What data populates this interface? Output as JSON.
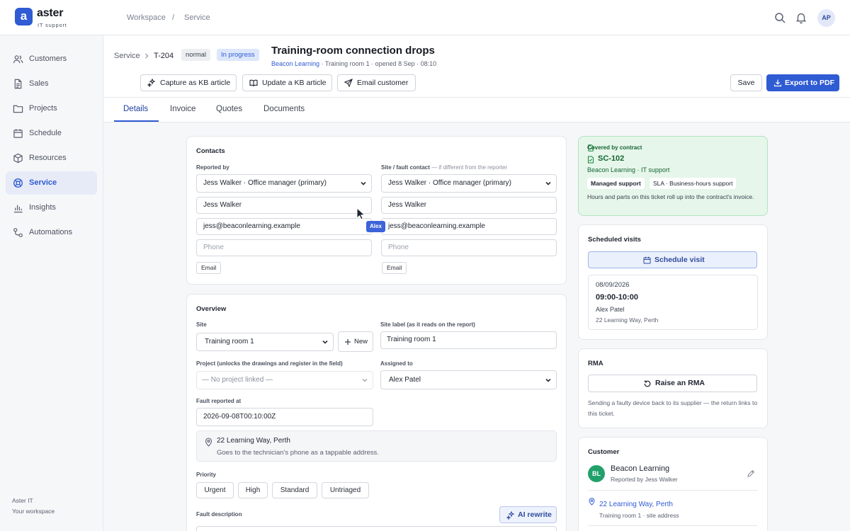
{
  "brand": {
    "logo_letter": "a",
    "name": "aster",
    "subtitle": "IT support"
  },
  "topbar": {
    "crumbs": [
      "Workspace",
      "/",
      "Service"
    ],
    "avatar": "AP"
  },
  "sidebar": {
    "items": [
      {
        "label": "Customers",
        "icon": "users-icon"
      },
      {
        "label": "Sales",
        "icon": "document-icon"
      },
      {
        "label": "Projects",
        "icon": "folder-icon"
      },
      {
        "label": "Schedule",
        "icon": "calendar-icon"
      },
      {
        "label": "Resources",
        "icon": "box-icon"
      },
      {
        "label": "Service",
        "icon": "lifebuoy-icon",
        "active": true
      },
      {
        "label": "Insights",
        "icon": "bar-chart-icon"
      },
      {
        "label": "Automations",
        "icon": "workflow-icon"
      }
    ],
    "footer_line1": "Aster IT",
    "footer_line2": "Your workspace"
  },
  "header": {
    "crumb_root": "Service",
    "ticket_id": "T-204",
    "priority_tag": "normal",
    "status_tag": "In progress",
    "title": "Training-room connection drops",
    "sub_link": "Beacon Learning",
    "sub_rest": " · Training room 1 · opened 8 Sep · 08:10",
    "actions": {
      "capture_kb": "Capture as KB article",
      "update_kb": "Update a KB article",
      "email_customer": "Email customer",
      "save": "Save",
      "export": "Export to PDF"
    }
  },
  "tabs": [
    "Details",
    "Invoice",
    "Quotes",
    "Documents"
  ],
  "contacts": {
    "title": "Contacts",
    "reported_by_label": "Reported by",
    "site_contact_label": "Site / fault contact",
    "site_contact_hint": " — if different from the reporter",
    "reporter": {
      "select": "Jess Walker · Office manager (primary)",
      "name": "Jess Walker",
      "email": "jess@beaconlearning.example",
      "phone_placeholder": "Phone",
      "chip": "Email"
    },
    "site_contact": {
      "select": "Jess Walker · Office manager (primary)",
      "name": "Jess Walker",
      "email": "jess@beaconlearning.example",
      "phone_placeholder": "Phone",
      "chip": "Email"
    },
    "presence_tag": "Alex"
  },
  "overview": {
    "title": "Overview",
    "site_label": "Site",
    "site_value": "Training room 1",
    "new_button": "New",
    "site_label_label": "Site label (as it reads on the report)",
    "site_label_value": "Training room 1",
    "project_label": "Project (unlocks the drawings and register in the field)",
    "project_value": "— No project linked —",
    "assigned_label": "Assigned to",
    "assigned_value": "Alex Patel",
    "fault_reported_label": "Fault reported at",
    "fault_reported_value": "2026-09-08T00:10:00Z",
    "address_line": "22 Learning Way, Perth",
    "address_note": "Goes to the technician's phone as a tappable address.",
    "priority_label": "Priority",
    "priorities": [
      "Urgent",
      "High",
      "Standard",
      "Untriaged"
    ],
    "fault_desc_label": "Fault description",
    "ai_rewrite": "AI rewrite"
  },
  "contract": {
    "heading": "Covered by contract",
    "code": "SC-102",
    "org": "Beacon Learning · IT support",
    "badge1": "Managed support",
    "badge2": "SLA · Business-hours support",
    "note": "Hours and parts on this ticket roll up into the contract's invoice."
  },
  "visits": {
    "title": "Scheduled visits",
    "schedule_button": "Schedule visit",
    "date": "08/09/2026",
    "time": "09:00-10:00",
    "tech": "Alex Patel",
    "address": "22 Learning Way, Perth"
  },
  "rma": {
    "title": "RMA",
    "button": "Raise an RMA",
    "note": "Sending a faulty device back to its supplier — the return links to this ticket."
  },
  "customer": {
    "title": "Customer",
    "initials": "BL",
    "name": "Beacon Learning",
    "reported_by": "Reported by Jess Walker",
    "address": "22 Learning Way, Perth",
    "address_note": "Training room 1 · site address"
  },
  "colors": {
    "accent": "#2f5bd3",
    "contract_bg": "#e6f6ea",
    "status_tag_bg": "#dde7fb",
    "customer_avatar": "#22a06b"
  }
}
